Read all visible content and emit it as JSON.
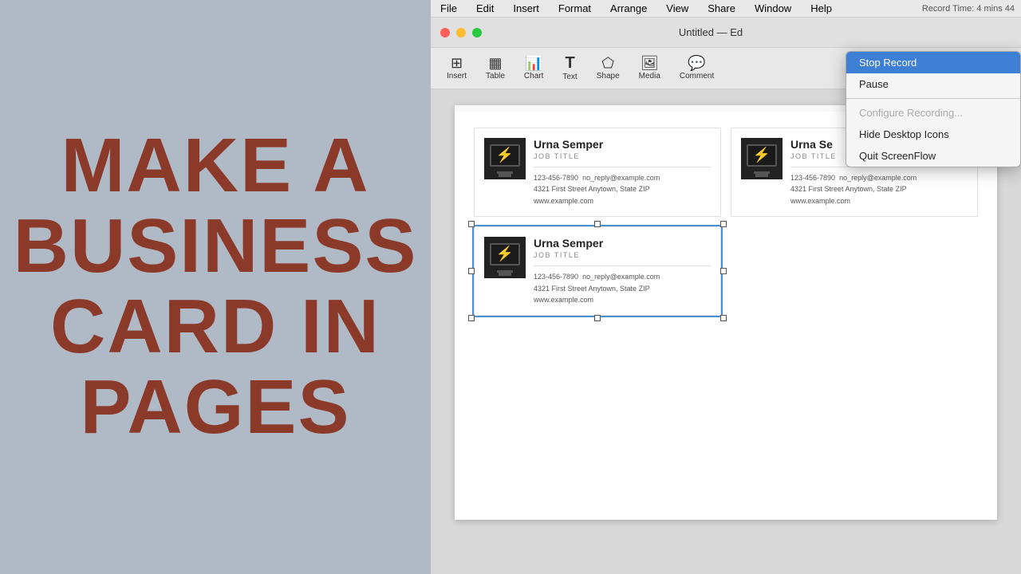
{
  "left_panel": {
    "title_line1": "MAKE A",
    "title_line2": "BUSINESS",
    "title_line3": "CARD IN",
    "title_line4": "PAGES"
  },
  "menubar": {
    "items": [
      "File",
      "Edit",
      "Insert",
      "Format",
      "Arrange",
      "View",
      "Share",
      "Window",
      "Help"
    ]
  },
  "titlebar": {
    "app_name": "Untitled — Ed",
    "record_label": "Record Time: 4 mins 44"
  },
  "toolbar": {
    "buttons": [
      {
        "label": "Insert",
        "icon": "⊞"
      },
      {
        "label": "Table",
        "icon": "▦"
      },
      {
        "label": "Chart",
        "icon": "📊"
      },
      {
        "label": "Text",
        "icon": "T"
      },
      {
        "label": "Shape",
        "icon": "⬠"
      },
      {
        "label": "Media",
        "icon": "🖼"
      },
      {
        "label": "Comment",
        "icon": "💬"
      }
    ]
  },
  "cards": [
    {
      "name": "Urna Semper",
      "job_title": "JOB TITLE",
      "phone": "123-456-7890",
      "email": "no_reply@example.com",
      "address": "4321 First Street  Anytown, State  ZIP",
      "website": "www.example.com",
      "selected": false
    },
    {
      "name": "Urna Se",
      "job_title": "JOB TITLE",
      "phone": "123-456-7890",
      "email": "no_reply@example.com",
      "address": "4321 First Street  Anytown, State  ZIP",
      "website": "www.example.com",
      "selected": false
    },
    {
      "name": "Urna Semper",
      "job_title": "JOB TITLE",
      "phone": "123-456-7890",
      "email": "no_reply@example.com",
      "address": "4321 First Street  Anytown, State  ZIP",
      "website": "www.example.com",
      "selected": true
    }
  ],
  "dropdown": {
    "items": [
      {
        "label": "Stop Record",
        "type": "highlighted"
      },
      {
        "label": "Pause",
        "type": "normal"
      },
      {
        "label": "separator"
      },
      {
        "label": "Configure Recording...",
        "type": "disabled"
      },
      {
        "label": "Hide Desktop Icons",
        "type": "normal"
      },
      {
        "label": "Quit ScreenFlow",
        "type": "normal"
      }
    ]
  }
}
